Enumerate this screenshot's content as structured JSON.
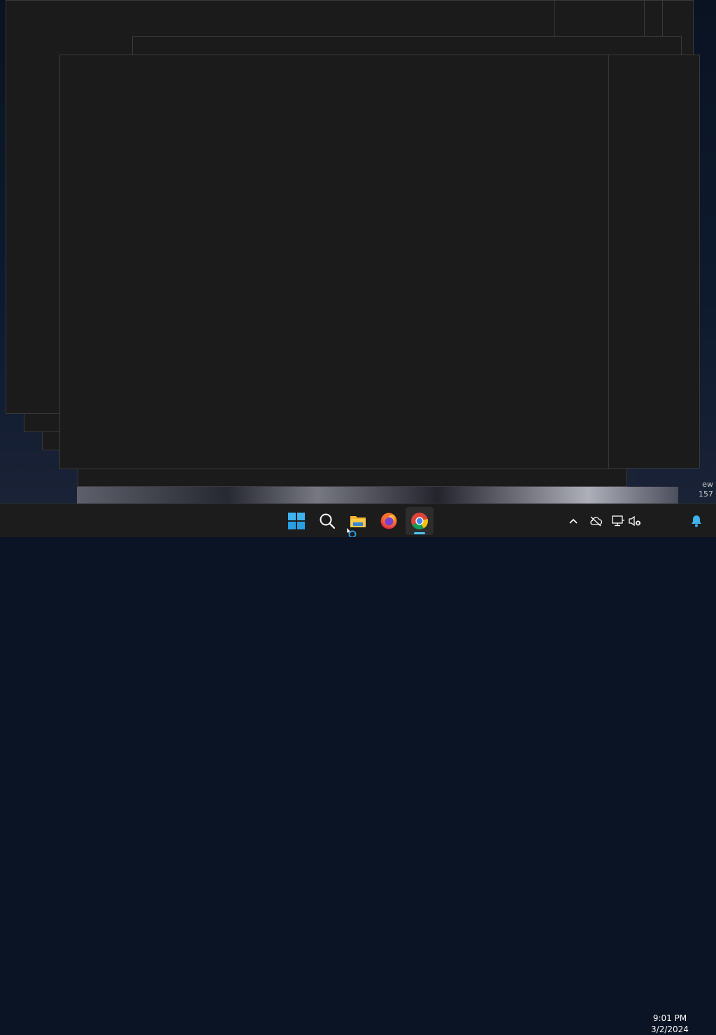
{
  "desktop": {
    "corner_text_line1": "ew",
    "corner_text_line2": "157"
  },
  "taskbar": {
    "start": {
      "icon": "windows-logo-icon"
    },
    "search": {
      "icon": "search-icon"
    },
    "apps": [
      {
        "name": "File Explorer",
        "icon": "folder-icon"
      },
      {
        "name": "Firefox",
        "icon": "firefox-icon"
      },
      {
        "name": "Google Chrome",
        "icon": "chrome-icon",
        "active": true
      }
    ],
    "tray": {
      "overflow_icon": "chevron-up-icon",
      "onedrive_icon": "cloud-offline-icon",
      "network_icon": "network-disconnected-icon",
      "volume_icon": "volume-muted-icon",
      "notification_icon": "bell-icon"
    },
    "clock": {
      "time": "9:01 PM",
      "date": "3/2/2024"
    }
  },
  "colors": {
    "window_bg": "#1b1b1b",
    "taskbar_bg": "#1c1c1c",
    "accent": "#4cc2ff"
  }
}
